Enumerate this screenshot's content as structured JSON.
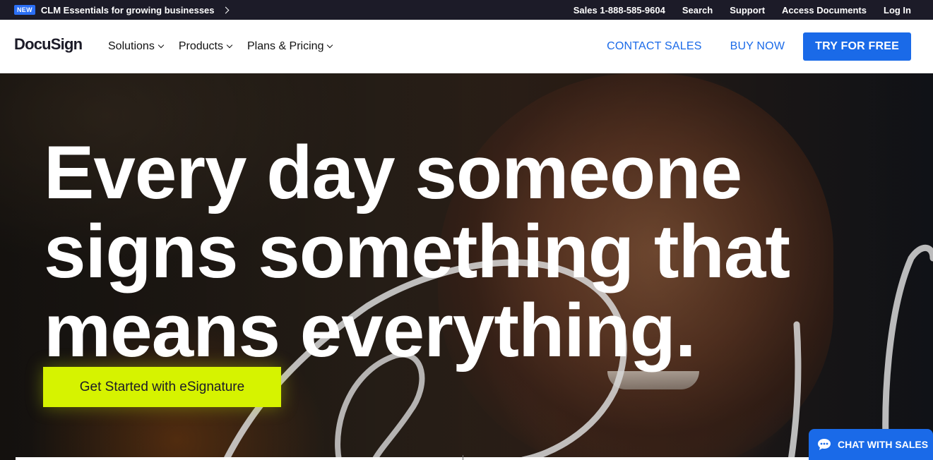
{
  "topbar": {
    "badge": "NEW",
    "promo": "CLM Essentials for growing businesses",
    "utility_links": [
      "Sales 1-888-585-9604",
      "Search",
      "Support",
      "Access Documents",
      "Log In"
    ]
  },
  "nav": {
    "logo": "DocuSign",
    "menu": [
      "Solutions",
      "Products",
      "Plans & Pricing"
    ],
    "contact_sales": "CONTACT SALES",
    "buy_now": "BUY NOW",
    "try_free": "TRY FOR FREE"
  },
  "hero": {
    "headline": [
      "Every day someone",
      "signs something that",
      "means everything."
    ],
    "cta": "Get Started with eSignature"
  },
  "chat": {
    "label": "CHAT WITH SALES"
  },
  "colors": {
    "topbar_bg": "#1c1b28",
    "brand_blue": "#1a6ae8",
    "cta_lime": "#d6f300",
    "text_dark": "#1c1b28"
  },
  "icons": [
    "chevron-right-icon",
    "chevron-down-icon",
    "chat-bubble-icon"
  ]
}
